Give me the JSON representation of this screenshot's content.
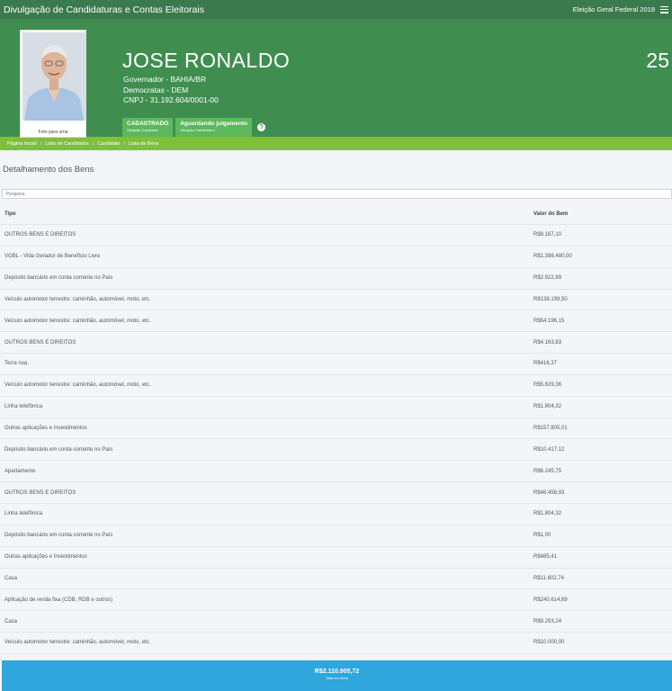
{
  "topbar": {
    "title": "Divulgação de Candidaturas e Contas Eleitorais",
    "election": "Eleição Geral Federal 2018"
  },
  "candidate": {
    "name": "JOSE RONALDO",
    "number": "25",
    "photo_caption": "Foto para urna",
    "office": "Governador - BAHIA/BR",
    "party": "Democratas - DEM",
    "cnpj": "CNPJ - 31.192.604/0001-00",
    "status_badge": {
      "main": "CADASTRADO",
      "sub": "Situação Candidato"
    },
    "judgement_badge": {
      "main": "Aguardando julgamento",
      "sub": "Situação Candidatura"
    }
  },
  "breadcrumb": [
    "Página Inicial",
    "Lista de Candidatos",
    "Candidato",
    "Lista de Bens"
  ],
  "section_title": "Detalhamento dos Bens",
  "search": {
    "placeholder": "Pesquisa"
  },
  "table": {
    "headers": {
      "tipo": "Tipo",
      "valor": "Valor do Bem"
    },
    "rows": [
      {
        "tipo": "OUTROS BENS E DIREITOS",
        "valor": "R$8.167,10"
      },
      {
        "tipo": "VGBL - Vida Gerador de Benefício Livre",
        "valor": "R$1.398.480,00"
      },
      {
        "tipo": "Depósito bancário em conta corrente no País",
        "valor": "R$2.922,89"
      },
      {
        "tipo": "Veículo automotor terrestre: caminhão, automóvel, moto, etc.",
        "valor": "R$138.199,50"
      },
      {
        "tipo": "Veículo automotor terrestre: caminhão, automóvel, moto, etc.",
        "valor": "R$54.196,15"
      },
      {
        "tipo": "OUTROS BENS E DIREITOS",
        "valor": "R$4.163,83"
      },
      {
        "tipo": "Terra nua",
        "valor": "R$416,37"
      },
      {
        "tipo": "Veículo automotor terrestre: caminhão, automóvel, moto, etc.",
        "valor": "R$5.829,36"
      },
      {
        "tipo": "Linha telefônica",
        "valor": "R$1.804,32"
      },
      {
        "tipo": "Outras aplicações e Investimentos",
        "valor": "R$157.805,01"
      },
      {
        "tipo": "Depósito bancário em conta corrente no País",
        "valor": "R$10.417,12"
      },
      {
        "tipo": "Apartamento",
        "valor": "R$6.245,75"
      },
      {
        "tipo": "OUTROS BENS E DIREITOS",
        "valor": "R$46.456,93"
      },
      {
        "tipo": "Linha telefônica",
        "valor": "R$1.804,32"
      },
      {
        "tipo": "Depósito bancário em conta corrente no País",
        "valor": "R$1,00"
      },
      {
        "tipo": "Outras aplicações e Investimentos",
        "valor": "R$485,41"
      },
      {
        "tipo": "Casa",
        "valor": "R$11.602,74"
      },
      {
        "tipo": "Aplicação de renda fixa (CDB, RDB e outros)",
        "valor": "R$240.614,69"
      },
      {
        "tipo": "Casa",
        "valor": "R$9.293,24"
      },
      {
        "tipo": "Veículo automotor terrestre: caminhão, automóvel, moto, etc.",
        "valor": "R$10.000,00"
      }
    ]
  },
  "total": {
    "value": "R$2.110.905,72",
    "label": "Total em Bens"
  },
  "colors": {
    "topbar": "#3a7a4c",
    "hero": "#3f8e4f",
    "breadcrumb": "#7fbf3a",
    "badge": "#5cb85c",
    "total": "#2fa6dc"
  }
}
